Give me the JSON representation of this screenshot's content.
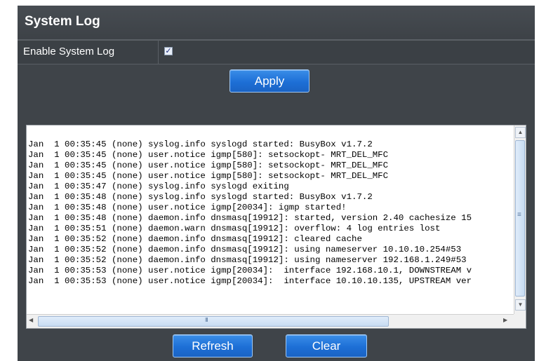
{
  "section": {
    "title": "System Log"
  },
  "settings": {
    "enable_label": "Enable System Log",
    "enable_checked": true,
    "checkbox_glyph": "✓"
  },
  "buttons": {
    "apply": "Apply",
    "refresh": "Refresh",
    "clear": "Clear"
  },
  "log": {
    "lines": [
      "Jan  1 00:35:45 (none) syslog.info syslogd started: BusyBox v1.7.2",
      "Jan  1 00:35:45 (none) user.notice igmp[580]: setsockopt- MRT_DEL_MFC",
      "Jan  1 00:35:45 (none) user.notice igmp[580]: setsockopt- MRT_DEL_MFC",
      "Jan  1 00:35:45 (none) user.notice igmp[580]: setsockopt- MRT_DEL_MFC",
      "Jan  1 00:35:47 (none) syslog.info syslogd exiting",
      "Jan  1 00:35:48 (none) syslog.info syslogd started: BusyBox v1.7.2",
      "Jan  1 00:35:48 (none) user.notice igmp[20034]: igmp started!",
      "Jan  1 00:35:48 (none) daemon.info dnsmasq[19912]: started, version 2.40 cachesize 15",
      "Jan  1 00:35:51 (none) daemon.warn dnsmasq[19912]: overflow: 4 log entries lost",
      "Jan  1 00:35:52 (none) daemon.info dnsmasq[19912]: cleared cache",
      "Jan  1 00:35:52 (none) daemon.info dnsmasq[19912]: using nameserver 10.10.10.254#53",
      "Jan  1 00:35:52 (none) daemon.info dnsmasq[19912]: using nameserver 192.168.1.249#53",
      "Jan  1 00:35:53 (none) user.notice igmp[20034]:  interface 192.168.10.1, DOWNSTREAM v",
      "Jan  1 00:35:53 (none) user.notice igmp[20034]:  interface 10.10.10.135, UPSTREAM ver"
    ],
    "scrollbar_glyphs": {
      "up": "▲",
      "down": "▼",
      "left": "◀",
      "right": "▶",
      "grip": "≡",
      "hgrip": "III"
    }
  }
}
